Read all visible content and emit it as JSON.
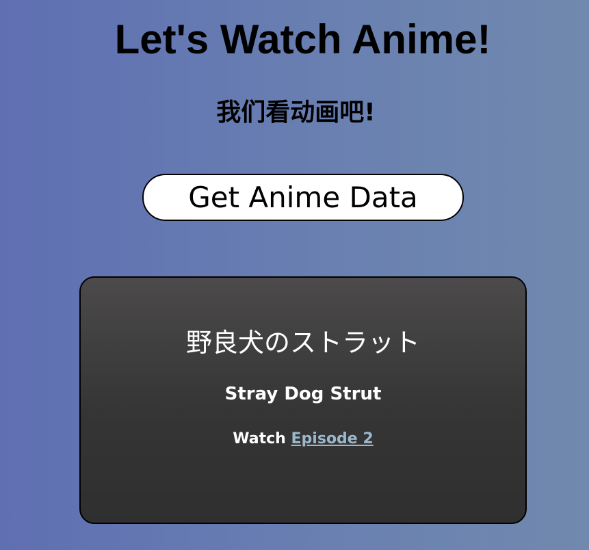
{
  "header": {
    "title": "Let's Watch Anime!",
    "subtitle": "我们看动画吧!"
  },
  "actions": {
    "get_data_label": "Get Anime Data"
  },
  "anime_card": {
    "japanese_title": "野良犬のストラット",
    "english_title": "Stray Dog Strut",
    "watch_prefix": "Watch",
    "episode_link": "Episode 2"
  },
  "colors": {
    "background_start": "#5f6fb2",
    "background_end": "#7189ae",
    "card_background": "#3a3a3a",
    "link": "#9bb7cc",
    "button_background": "#ffffff"
  }
}
